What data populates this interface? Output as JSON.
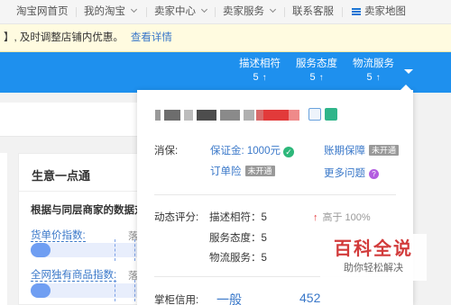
{
  "top_nav": {
    "items": [
      {
        "label": "淘宝网首页"
      },
      {
        "label": "我的淘宝"
      },
      {
        "label": "卖家中心"
      },
      {
        "label": "卖家服务"
      },
      {
        "label": "联系客服"
      },
      {
        "label": "卖家地图"
      }
    ]
  },
  "notice": {
    "text": "】, 及时调整店铺内优惠。",
    "link": "查看详情"
  },
  "header_ratings": [
    {
      "label": "描述相符",
      "value": "5",
      "arrow": "↑"
    },
    {
      "label": "服务态度",
      "value": "5",
      "arrow": "↑"
    },
    {
      "label": "物流服务",
      "value": "5",
      "arrow": "↑"
    }
  ],
  "card": {
    "title": "生意一点通",
    "subtitle": "根据与同层商家的数据对",
    "metrics": [
      {
        "label": "货单价指数:",
        "trunc": "落"
      },
      {
        "label": "全网独有商品指数:",
        "trunc": "落"
      }
    ]
  },
  "popup": {
    "guarantee": {
      "label": "消保:",
      "deposit": "保证金: 1000元",
      "order_insurance": "订单险",
      "order_insurance_tag": "未开通",
      "period_guarantee": "账期保障",
      "period_guarantee_tag": "未开通",
      "more_questions": "更多问题",
      "qmark": "?"
    },
    "dynamic": {
      "label": "动态评分:",
      "rows": [
        {
          "name": "描述相符",
          "score": "5"
        },
        {
          "name": "服务态度",
          "score": "5"
        },
        {
          "name": "物流服务",
          "score": "5"
        }
      ],
      "compare": "高于 100%"
    },
    "credit": {
      "label": "掌柜信用:",
      "level": "一般",
      "number": "452"
    }
  },
  "watermark": {
    "title": "百科全说",
    "subtitle": "助你轻松解决"
  },
  "colors": {
    "brand_blue": "#1e90ee",
    "link_blue": "#3a78c9",
    "notice_bg": "#fffbe0",
    "check_green": "#2db77a",
    "up_red": "#e4393c"
  }
}
